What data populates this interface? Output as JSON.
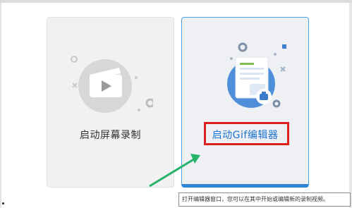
{
  "cards": [
    {
      "label": "启动屏幕录制",
      "icon": "video-clapper-icon",
      "accent": "#9a9a9a"
    },
    {
      "label": "启动Gif编辑器",
      "icon": "gif-document-icon",
      "accent": "#2f86d6"
    }
  ],
  "tooltip": "打开编辑器窗口，您可以在其中开始或编辑新的录制视频。",
  "colors": {
    "highlight_border": "#e0201e",
    "arrow": "#27b36a",
    "selected_border": "#4aa3e6"
  }
}
